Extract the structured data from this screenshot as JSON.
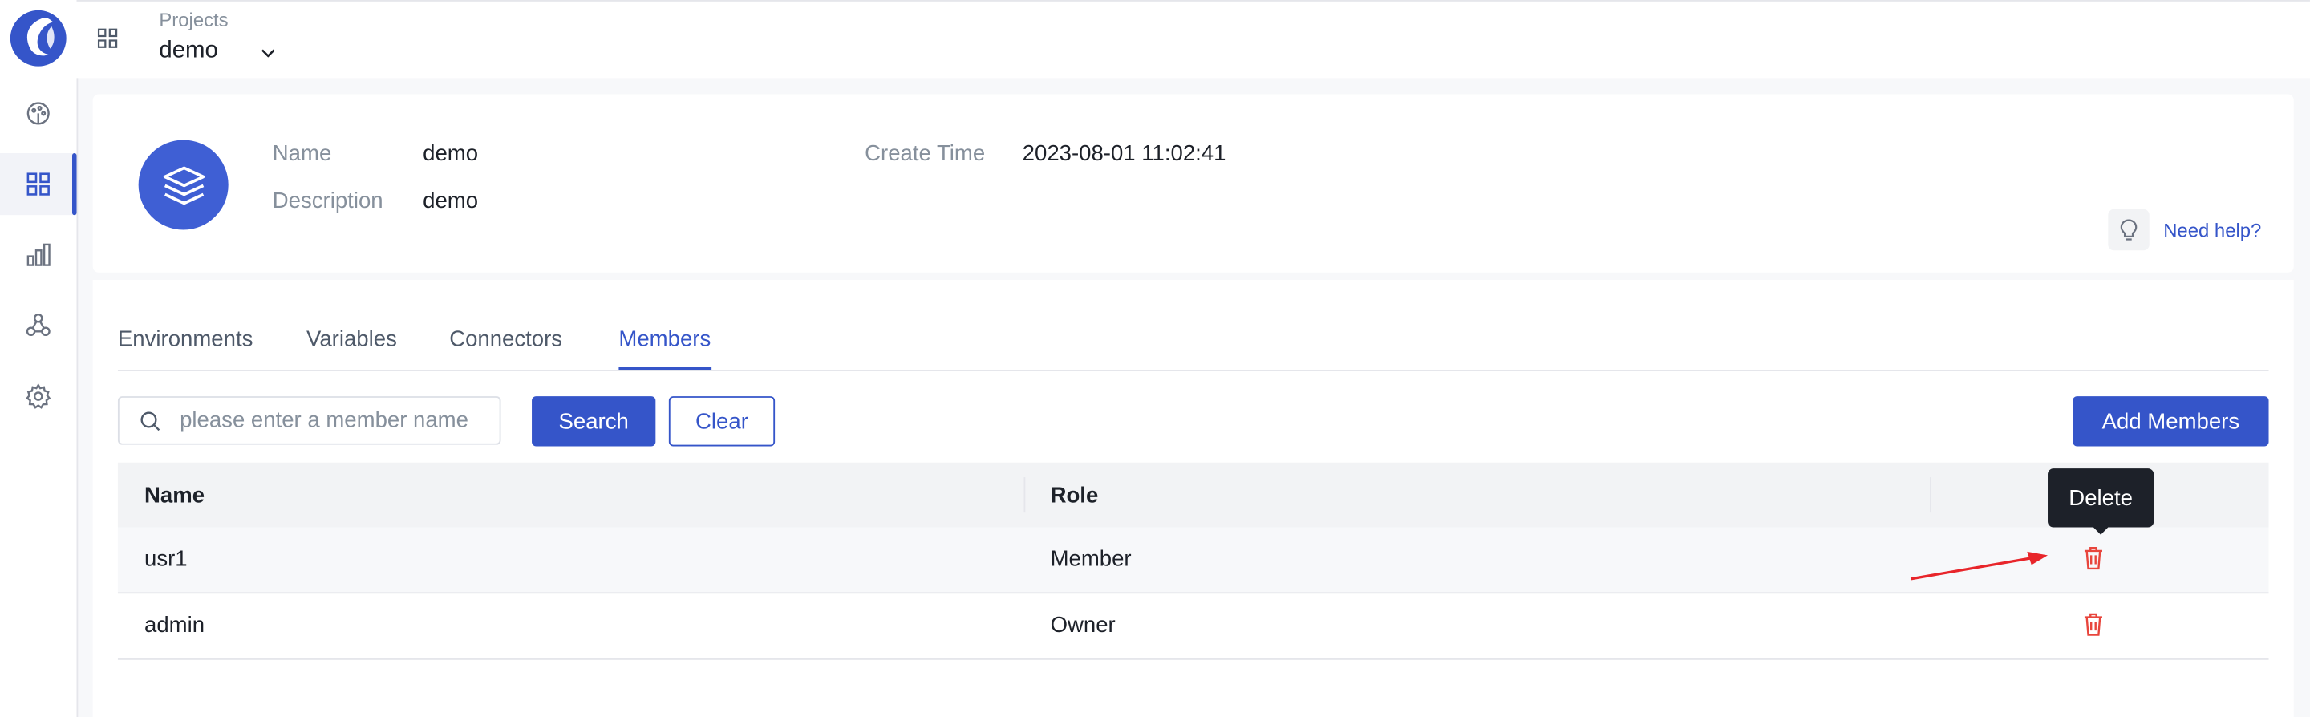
{
  "sidebar": {
    "logo": "app-logo",
    "items": [
      {
        "name": "dashboard",
        "icon": "palette-icon",
        "active": false
      },
      {
        "name": "projects",
        "icon": "grid-icon",
        "active": true
      },
      {
        "name": "reports",
        "icon": "bar-chart-icon",
        "active": false
      },
      {
        "name": "integrations",
        "icon": "nodes-icon",
        "active": false
      },
      {
        "name": "settings",
        "icon": "gear-icon",
        "active": false
      }
    ]
  },
  "header": {
    "caption": "Projects",
    "project_name": "demo"
  },
  "project_info": {
    "name_label": "Name",
    "name_value": "demo",
    "description_label": "Description",
    "description_value": "demo",
    "create_time_label": "Create Time",
    "create_time_value": "2023-08-01 11:02:41",
    "help_label": "Need help?"
  },
  "tabs": [
    {
      "label": "Environments",
      "active": false
    },
    {
      "label": "Variables",
      "active": false
    },
    {
      "label": "Connectors",
      "active": false
    },
    {
      "label": "Members",
      "active": true
    }
  ],
  "search": {
    "placeholder": "please enter a member name",
    "value": "",
    "search_label": "Search",
    "clear_label": "Clear",
    "add_label": "Add Members"
  },
  "table": {
    "columns": [
      "Name",
      "Role"
    ],
    "rows": [
      {
        "name": "usr1",
        "role": "Member"
      },
      {
        "name": "admin",
        "role": "Owner"
      }
    ]
  },
  "tooltip": {
    "text": "Delete"
  },
  "colors": {
    "primary": "#3555c9",
    "danger": "#e8453c",
    "annotation_arrow": "#e8252a"
  }
}
